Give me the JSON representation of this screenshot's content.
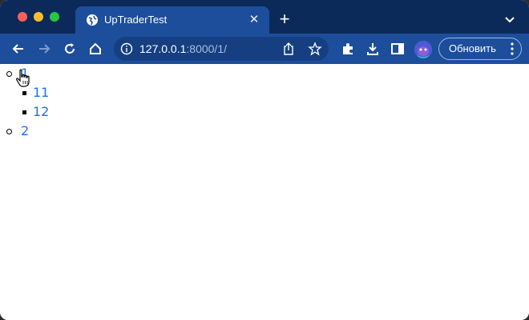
{
  "tab": {
    "title": "UpTraderTest",
    "close_glyph": "✕"
  },
  "new_tab_glyph": "+",
  "address": {
    "host": "127.0.0.1",
    "path": ":8000/1/"
  },
  "toolbar": {
    "update_label": "Обновить"
  },
  "icons": {
    "favicon": "globe-icon",
    "back": "back-arrow-icon",
    "forward": "forward-arrow-icon",
    "reload": "reload-icon",
    "home": "home-icon",
    "info": "info-icon",
    "share": "share-icon",
    "bookmark": "star-icon",
    "extensions": "puzzle-icon",
    "downloads": "download-icon",
    "side_panel": "side-panel-icon",
    "menu": "more-vertical-icon",
    "cursor": "hand-pointer-icon"
  },
  "colors": {
    "tab_strip": "#0c2a59",
    "toolbar": "#1d4e9c",
    "link": "#1a73e8"
  },
  "menu": {
    "items": [
      {
        "label": "1",
        "children": [
          {
            "label": "11"
          },
          {
            "label": "12"
          }
        ]
      },
      {
        "label": "2",
        "children": []
      }
    ]
  }
}
